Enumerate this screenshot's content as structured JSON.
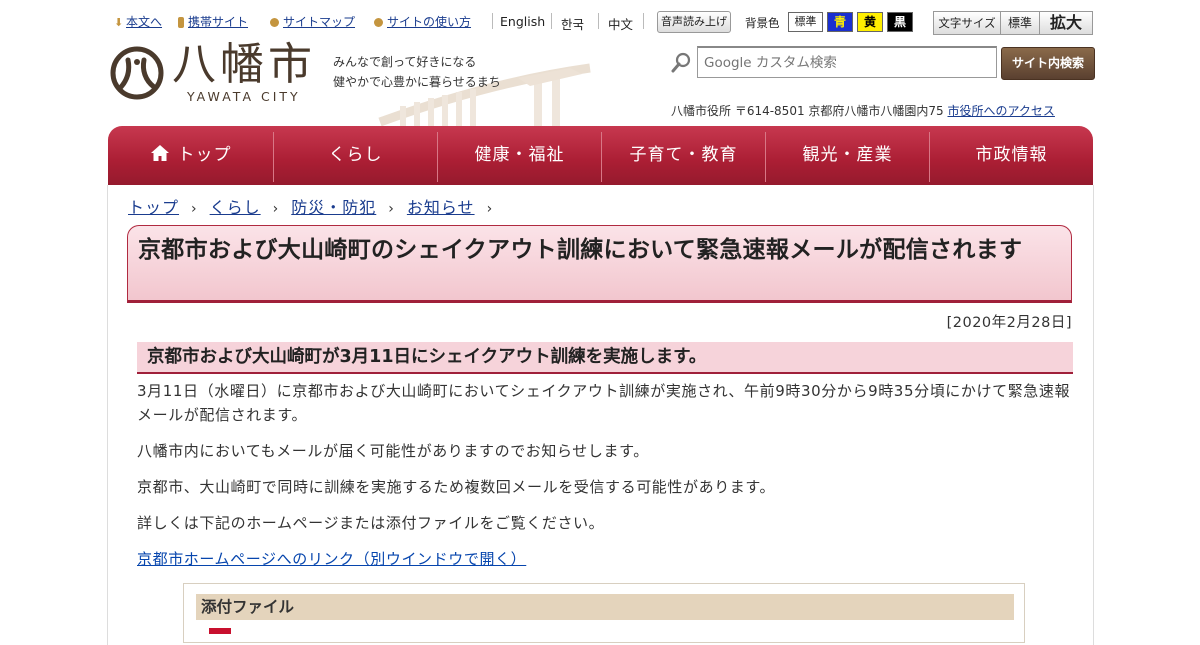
{
  "utility": {
    "skip_link": "本文へ",
    "mobile_site": "携帯サイト",
    "sitemap": "サイトマップ",
    "how_to_use": "サイトの使い方",
    "lang_en": "English",
    "lang_ko": "한국",
    "lang_zh": "中文",
    "speech": "音声読み上げ",
    "bg_label": "背景色",
    "bg_standard": "標準",
    "bg_blue": "青",
    "bg_yellow": "黄",
    "bg_black": "黒",
    "font_size_label": "文字サイズ",
    "font_standard": "標準",
    "font_large": "拡大"
  },
  "header": {
    "logo_title": "八幡市",
    "logo_subtitle": "YAWATA CITY",
    "tagline_1": "みんなで創って好きになる",
    "tagline_2": "健やかで心豊かに暮らせるまち",
    "search_placeholder": "Google カスタム検索",
    "search_button": "サイト内検索",
    "address": "八幡市役所 〒614-8501 京都府八幡市八幡園内75",
    "access_link": "市役所へのアクセス"
  },
  "nav": {
    "items": [
      "トップ",
      "くらし",
      "健康・福祉",
      "子育て・教育",
      "観光・産業",
      "市政情報"
    ]
  },
  "breadcrumb": [
    "トップ",
    "くらし",
    "防災・防犯",
    "お知らせ"
  ],
  "article": {
    "title": "京都市および大山崎町のシェイクアウト訓練において緊急速報メールが配信されます",
    "date": "[2020年2月28日]",
    "subheading": "京都市および大山崎町が3月11日にシェイクアウト訓練を実施します。",
    "paragraphs": [
      "3月11日（水曜日）に京都市および大山崎町においてシェイクアウト訓練が実施され、午前9時30分から9時35分頃にかけて緊急速報メールが配信されます。",
      "八幡市内においてもメールが届く可能性がありますのでお知らせします。",
      "京都市、大山崎町で同時に訓練を実施するため複数回メールを受信する可能性があります。",
      "詳しくは下記のホームページまたは添付ファイルをご覧ください。"
    ],
    "link_text": "京都市ホームページへのリンク（別ウインドウで開く）",
    "attachment_heading": "添付ファイル"
  },
  "colors": {
    "nav_red": "#ab1e34",
    "heading_pink": "#f2c6ce",
    "attachment_tan": "#e4d4bc",
    "link_blue": "#1a3c8e"
  }
}
